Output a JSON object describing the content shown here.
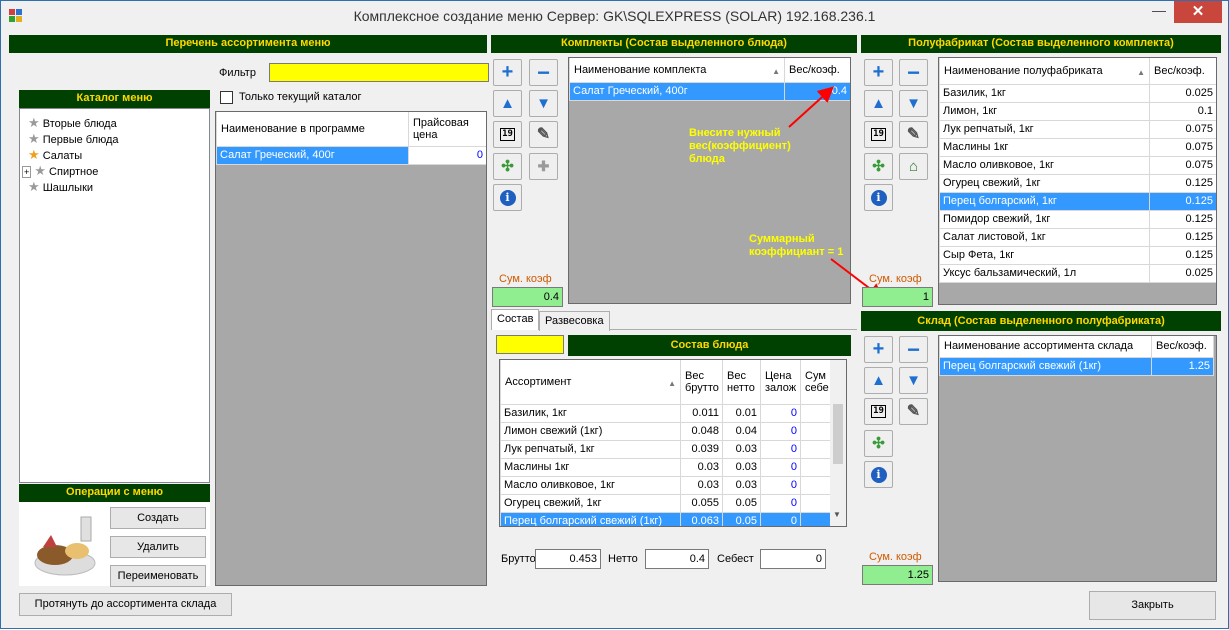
{
  "window": {
    "title": "Комплексное создание меню  Сервер: GK\\SQLEXPRESS (SOLAR) 192.168.236.1",
    "minimize": "—",
    "close": "✕"
  },
  "left": {
    "header": "Перечень ассортимента меню",
    "filter_label": "Фильтр",
    "filter_value": "",
    "only_current_label": "Только текущий каталог",
    "catalog_header": "Каталог меню",
    "tree": [
      "Вторые блюда",
      "Первые блюда",
      "Салаты",
      "Спиртное",
      "Шашлыки"
    ],
    "grid_cols": [
      "Наименование в программе",
      "Прайсовая цена"
    ],
    "grid_rows": [
      {
        "name": "Салат Греческий, 400г",
        "price": "0"
      }
    ],
    "ops_header": "Операции с меню",
    "btn_create": "Создать",
    "btn_delete": "Удалить",
    "btn_rename": "Переименовать",
    "btn_pull": "Протянуть до ассортимента склада"
  },
  "kits": {
    "header": "Комплекты (Состав выделенного блюда)",
    "cols": [
      "Наименование комплекта",
      "Вес/коэф."
    ],
    "rows": [
      {
        "name": "Салат Греческий, 400г",
        "w": "0.4"
      }
    ],
    "sum_label": "Сум. коэф",
    "sum_value": "0.4",
    "anno1": "Внесите нужный вес(коэффициент) блюда",
    "anno2": "Суммарный коэффициант = 1"
  },
  "semi": {
    "header": "Полуфабрикат (Состав выделенного комплекта)",
    "cols": [
      "Наименование полуфабриката",
      "Вес/коэф."
    ],
    "rows": [
      {
        "name": "Базилик, 1кг",
        "w": "0.025"
      },
      {
        "name": "Лимон, 1кг",
        "w": "0.1"
      },
      {
        "name": "Лук репчатый, 1кг",
        "w": "0.075"
      },
      {
        "name": "Маслины 1кг",
        "w": "0.075"
      },
      {
        "name": "Масло оливковое, 1кг",
        "w": "0.075"
      },
      {
        "name": "Огурец свежий, 1кг",
        "w": "0.125"
      },
      {
        "name": "Перец болгарский, 1кг",
        "w": "0.125",
        "sel": true
      },
      {
        "name": "Помидор свежий, 1кг",
        "w": "0.125"
      },
      {
        "name": "Салат листовой, 1кг",
        "w": "0.125"
      },
      {
        "name": "Сыр Фета, 1кг",
        "w": "0.125"
      },
      {
        "name": "Уксус бальзамический, 1л",
        "w": "0.025"
      }
    ],
    "sum_label": "Сум. коэф",
    "sum_value": "1"
  },
  "stock": {
    "header": "Склад (Состав выделенного полуфабриката)",
    "cols": [
      "Наименование ассортимента склада",
      "Вес/коэф."
    ],
    "rows": [
      {
        "name": "Перец болгарский свежий (1кг)",
        "w": "1.25"
      }
    ],
    "sum_label": "Сум. коэф",
    "sum_value": "1.25",
    "btn_close": "Закрыть"
  },
  "comp": {
    "tab1": "Состав",
    "tab2": "Развесовка",
    "header": "Состав блюда",
    "cols": [
      "Ассортимент",
      "Вес брутто",
      "Вес нетто",
      "Цена залож",
      "Сум себе"
    ],
    "rows": [
      {
        "n": "Базилик, 1кг",
        "b": "0.011",
        "ne": "0.01",
        "p": "0"
      },
      {
        "n": "Лимон свежий (1кг)",
        "b": "0.048",
        "ne": "0.04",
        "p": "0"
      },
      {
        "n": "Лук репчатый, 1кг",
        "b": "0.039",
        "ne": "0.03",
        "p": "0"
      },
      {
        "n": "Маслины 1кг",
        "b": "0.03",
        "ne": "0.03",
        "p": "0"
      },
      {
        "n": "Масло оливковое, 1кг",
        "b": "0.03",
        "ne": "0.03",
        "p": "0"
      },
      {
        "n": "Огурец свежий, 1кг",
        "b": "0.055",
        "ne": "0.05",
        "p": "0"
      },
      {
        "n": "Перец болгарский свежий (1кг)",
        "b": "0.063",
        "ne": "0.05",
        "p": "0",
        "sel": true
      }
    ],
    "brutto_label": "Брутто",
    "brutto": "0.453",
    "netto_label": "Нетто",
    "netto": "0.4",
    "cost_label": "Себест",
    "cost": "0"
  },
  "colors": {
    "header_bg": "#004000",
    "header_text": "#ffd800",
    "selection": "#3399ff",
    "sum_bg": "#90ee90",
    "annotation": "#ffff00",
    "arrow": "#ff0000"
  }
}
